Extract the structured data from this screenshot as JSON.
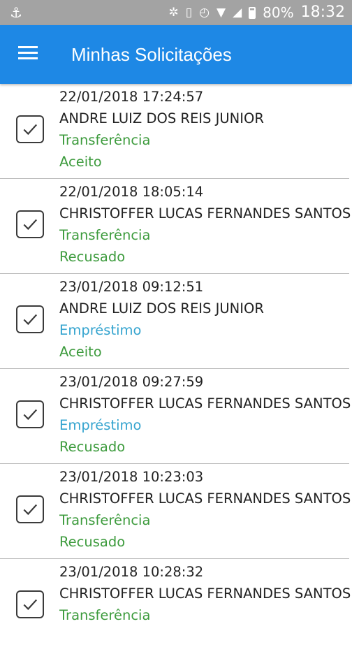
{
  "status_bar": {
    "battery": "80%",
    "time": "18:32",
    "icons": [
      "usb-icon",
      "bluetooth-icon",
      "vibrate-icon",
      "alarm-icon",
      "wifi-icon",
      "signal-icon",
      "battery-icon"
    ]
  },
  "app_bar": {
    "title": "Minhas Solicitações",
    "menu_icon": "hamburger-menu-icon"
  },
  "colors": {
    "app_bar": "#1e88e5",
    "transferencia": "#3d9b3d",
    "emprestimo": "#35a4cf",
    "status": "#3d9b3d"
  },
  "requests": [
    {
      "datetime": "22/01/2018 17:24:57",
      "name": "ANDRE LUIZ DOS REIS JUNIOR",
      "type": "Transferência",
      "type_kind": "green",
      "status": "Aceito",
      "checked": true
    },
    {
      "datetime": "22/01/2018 18:05:14",
      "name": "CHRISTOFFER LUCAS FERNANDES SANTOS",
      "type": "Transferência",
      "type_kind": "green",
      "status": "Recusado",
      "checked": true
    },
    {
      "datetime": "23/01/2018 09:12:51",
      "name": "ANDRE LUIZ DOS REIS JUNIOR",
      "type": "Empréstimo",
      "type_kind": "blue",
      "status": "Aceito",
      "checked": true
    },
    {
      "datetime": "23/01/2018 09:27:59",
      "name": "CHRISTOFFER LUCAS FERNANDES SANTOS",
      "type": "Empréstimo",
      "type_kind": "blue",
      "status": "Recusado",
      "checked": true
    },
    {
      "datetime": "23/01/2018 10:23:03",
      "name": "CHRISTOFFER LUCAS FERNANDES SANTOS",
      "type": "Transferência",
      "type_kind": "green",
      "status": "Recusado",
      "checked": true
    },
    {
      "datetime": "23/01/2018 10:28:32",
      "name": "CHRISTOFFER LUCAS FERNANDES SANTOS",
      "type": "Transferência",
      "type_kind": "green",
      "status": "",
      "checked": true
    }
  ]
}
